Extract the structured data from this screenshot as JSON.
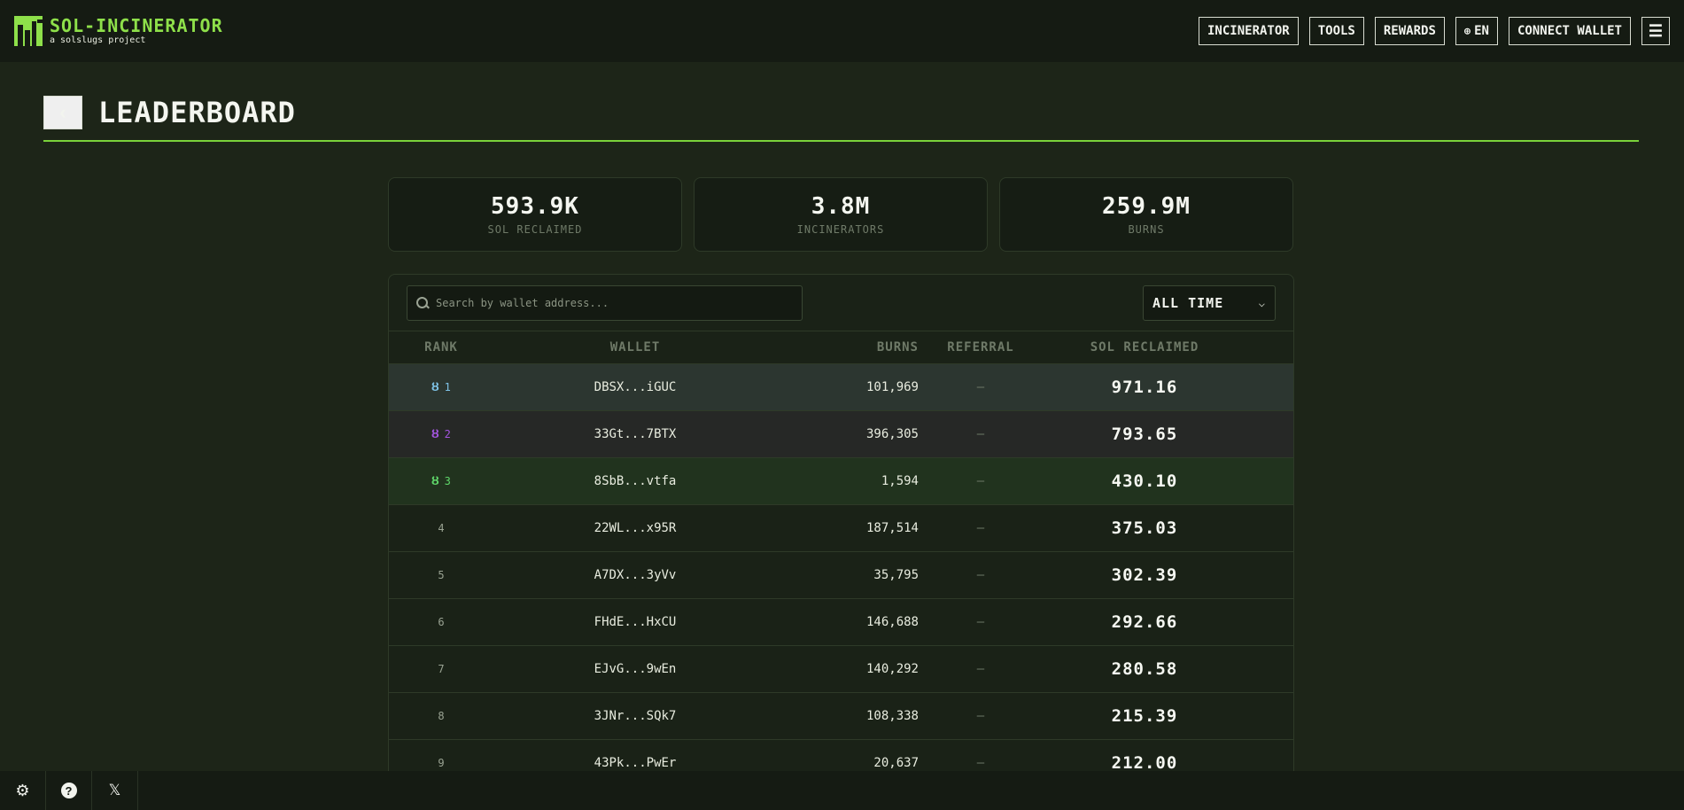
{
  "brand": {
    "title": "SOL-INCINERATOR",
    "subtitle": "a solslugs project"
  },
  "nav": {
    "incinerator": "INCINERATOR",
    "tools": "TOOLS",
    "rewards": "REWARDS",
    "language": "EN",
    "connect": "CONNECT WALLET"
  },
  "page": {
    "title": "LEADERBOARD"
  },
  "stats": [
    {
      "value": "593.9K",
      "label": "SOL RECLAIMED"
    },
    {
      "value": "3.8M",
      "label": "INCINERATORS"
    },
    {
      "value": "259.9M",
      "label": "BURNS"
    }
  ],
  "search": {
    "placeholder": "Search by wallet address..."
  },
  "period": {
    "selected": "ALL TIME"
  },
  "table": {
    "headers": {
      "rank": "RANK",
      "wallet": "WALLET",
      "burns": "BURNS",
      "referral": "REFERRAL",
      "sol": "SOL RECLAIMED"
    },
    "rows": [
      {
        "rank": "1",
        "wallet": "DBSX...iGUC",
        "burns": "101,969",
        "referral": "–",
        "sol": "971.16",
        "medal_color": "#7fc4e8"
      },
      {
        "rank": "2",
        "wallet": "33Gt...7BTX",
        "burns": "396,305",
        "referral": "–",
        "sol": "793.65",
        "medal_color": "#a455e0"
      },
      {
        "rank": "3",
        "wallet": "8SbB...vtfa",
        "burns": "1,594",
        "referral": "–",
        "sol": "430.10",
        "medal_color": "#5fd86a"
      },
      {
        "rank": "4",
        "wallet": "22WL...x95R",
        "burns": "187,514",
        "referral": "–",
        "sol": "375.03"
      },
      {
        "rank": "5",
        "wallet": "A7DX...3yVv",
        "burns": "35,795",
        "referral": "–",
        "sol": "302.39"
      },
      {
        "rank": "6",
        "wallet": "FHdE...HxCU",
        "burns": "146,688",
        "referral": "–",
        "sol": "292.66"
      },
      {
        "rank": "7",
        "wallet": "EJvG...9wEn",
        "burns": "140,292",
        "referral": "–",
        "sol": "280.58"
      },
      {
        "rank": "8",
        "wallet": "3JNr...SQk7",
        "burns": "108,338",
        "referral": "–",
        "sol": "215.39"
      },
      {
        "rank": "9",
        "wallet": "43Pk...PwEr",
        "burns": "20,637",
        "referral": "–",
        "sol": "212.00"
      }
    ]
  },
  "colors": {
    "accent": "#8ee04a",
    "background": "#1d2518"
  },
  "icons": {
    "logo": "building-logo-icon",
    "globe": "globe-icon",
    "menu": "hamburger-icon",
    "back": "chevron-left-icon",
    "search": "search-icon",
    "dropdown": "chevron-down-icon",
    "medal": "medal-icon",
    "settings": "gear-icon",
    "help": "question-icon",
    "x": "x-logo-icon"
  }
}
